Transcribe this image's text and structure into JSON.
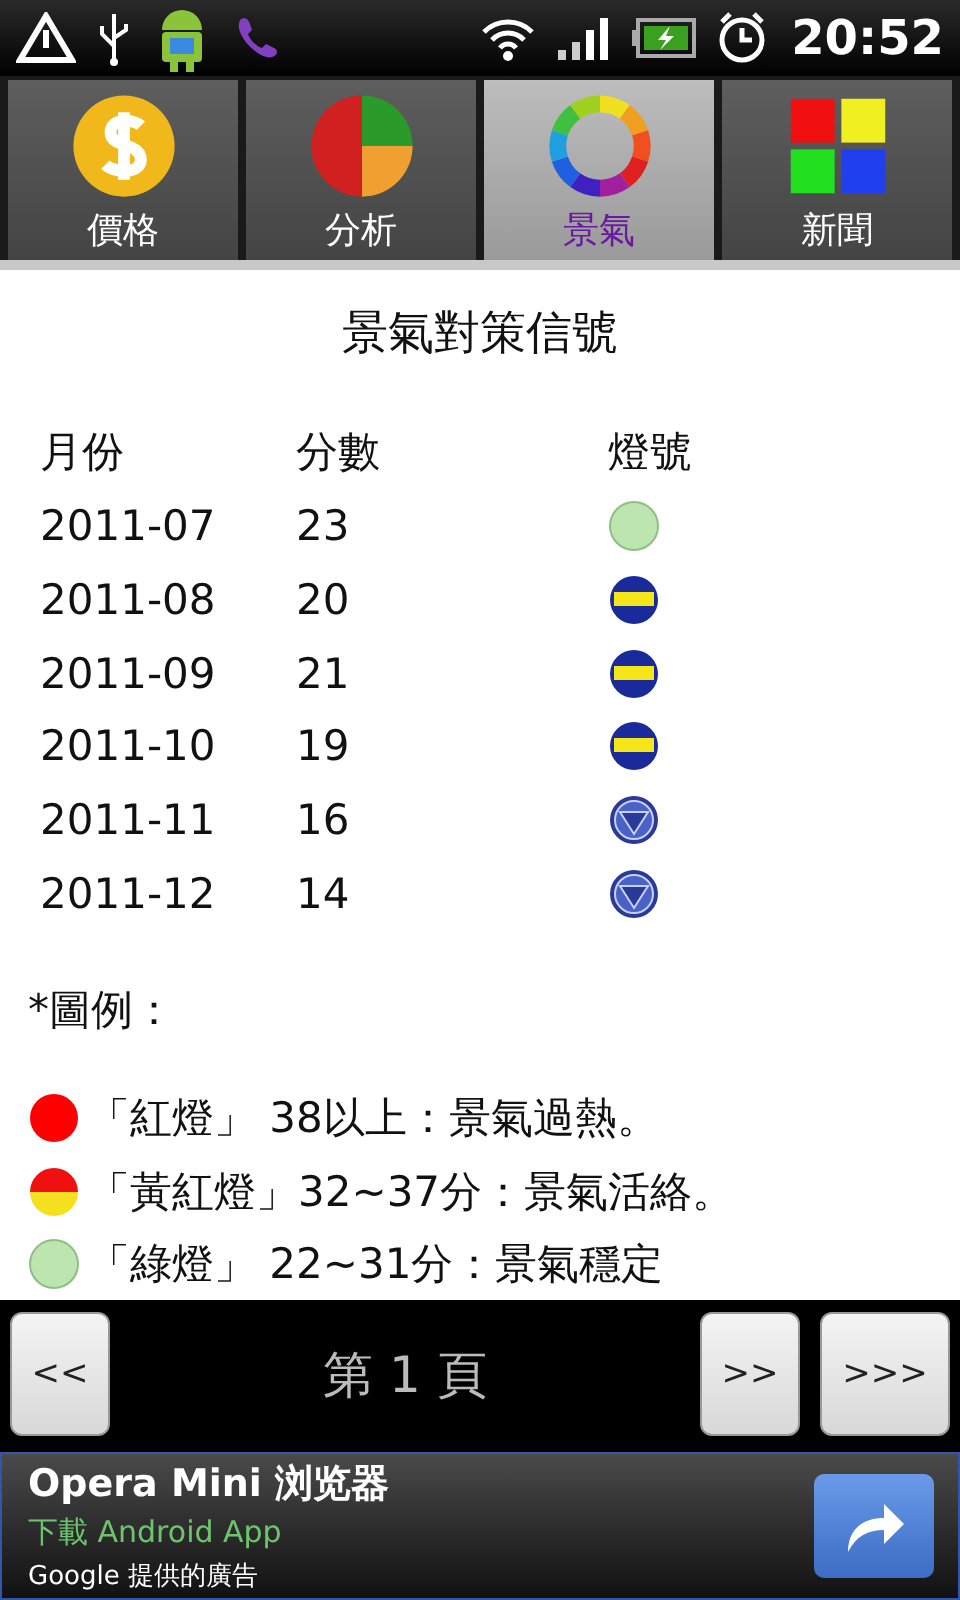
{
  "status_bar": {
    "time": "20:52"
  },
  "tabs": [
    {
      "label": "價格",
      "selected": false
    },
    {
      "label": "分析",
      "selected": false
    },
    {
      "label": "景氣",
      "selected": true
    },
    {
      "label": "新聞",
      "selected": false
    }
  ],
  "title": "景氣對策信號",
  "table": {
    "columns": [
      "月份",
      "分數",
      "燈號"
    ],
    "rows": [
      {
        "month": "2011-07",
        "score": "23",
        "kind": "stable"
      },
      {
        "month": "2011-08",
        "score": "20",
        "kind": "lowish"
      },
      {
        "month": "2011-09",
        "score": "21",
        "kind": "lowish"
      },
      {
        "month": "2011-10",
        "score": "19",
        "kind": "lowish"
      },
      {
        "month": "2011-11",
        "score": "16",
        "kind": "low"
      },
      {
        "month": "2011-12",
        "score": "14",
        "kind": "low"
      }
    ]
  },
  "legend_title": "*圖例：",
  "legend": [
    {
      "kind": "hot",
      "text": "「紅燈」 38以上：景氣過熱。"
    },
    {
      "kind": "warm",
      "text": "「黃紅燈」32~37分：景氣活絡。"
    },
    {
      "kind": "stable",
      "text": "「綠燈」 22~31分：景氣穩定"
    }
  ],
  "pager": {
    "first": "<<",
    "page": "第 1 頁",
    "next": ">>",
    "last": ">>>"
  },
  "ad": {
    "title": "Opera Mini 浏览器",
    "subtitle": "下載 Android App",
    "source": "Google 提供的廣告"
  }
}
